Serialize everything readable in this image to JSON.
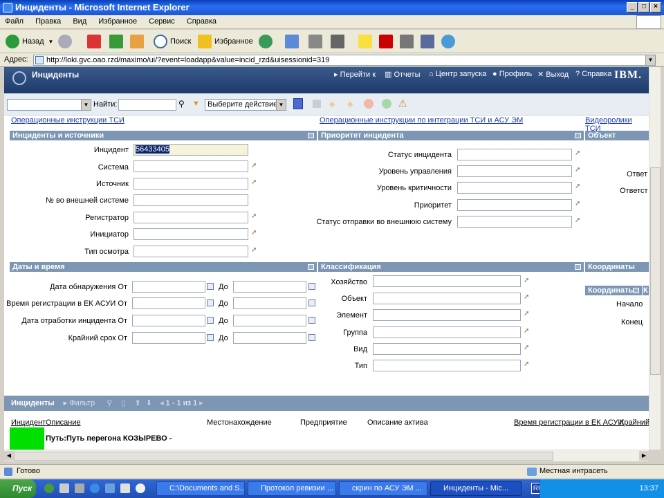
{
  "window": {
    "title": "Инциденты - Microsoft Internet Explorer"
  },
  "menu": [
    "Файл",
    "Правка",
    "Вид",
    "Избранное",
    "Сервис",
    "Справка"
  ],
  "toolbar": {
    "back": "Назад",
    "search": "Поиск",
    "favorites": "Избранное"
  },
  "address": {
    "label": "Адрес:",
    "url": "http://loki.gvc.oao.rzd/maximo/ui/?event=loadapp&value=incid_rzd&uisessionid=319"
  },
  "app": {
    "title": "Инциденты",
    "nav": [
      "Перейти к",
      "Отчеты",
      "Центр запуска",
      "Профиль",
      "Выход",
      "Справка"
    ],
    "brand": "IBM."
  },
  "actions": {
    "find_label": "Найти:",
    "action_select": "Выберите действие"
  },
  "links": {
    "l1": "Операционные инструкции ТСИ",
    "l2": "Операционные инструкции по интеграции ТСИ и АСУ ЭМ",
    "l3": "Видеоролики ТСИ"
  },
  "sections": {
    "incidents": "Инциденты и источники",
    "priority": "Приоритет инцидента",
    "object": "Объект",
    "dates": "Даты и время",
    "classification": "Классификация",
    "coords": "Координаты",
    "coords_sub": "Координаты",
    "coords_sub2": "К"
  },
  "incident_fields": {
    "incident": "Инцидент",
    "incident_value": "56433405",
    "system": "Система",
    "source": "Источник",
    "ext_number": "№ во внешней системе",
    "registrar": "Регистратор",
    "initiator": "Инициатор",
    "inspection": "Тип осмотра"
  },
  "priority_fields": {
    "status": "Статус инцидента",
    "mgmt_level": "Уровень управления",
    "crit_level": "Уровень критичности",
    "priority": "Приоритет",
    "ext_status": "Статус отправки во внешнюю систему"
  },
  "object_fields": {
    "resp1": "Ответ",
    "resp2": "Ответст"
  },
  "date_fields": {
    "detect": "Дата обнаружения От",
    "reg": "Время регистрации в ЕК АСУИ От",
    "work": "Дата отработки инцидента От",
    "deadline": "Крайний срок От",
    "to": "До"
  },
  "class_fields": {
    "farm": "Хозяйство",
    "object": "Объект",
    "element": "Элемент",
    "group": "Группа",
    "kind": "Вид",
    "type": "Тип"
  },
  "coord_fields": {
    "start": "Начало",
    "end": "Конец"
  },
  "table": {
    "title": "Инциденты",
    "filter": "Фильтр",
    "pager": "1 - 1 из 1",
    "columns": [
      "Инцидент",
      "Описание",
      "Местонахождение",
      "Предприятие",
      "Описание актива",
      "Время регистрации в ЕК АСУИ",
      "Крайний"
    ],
    "row_text": "Путь:Путь перегона КОЗЫРЕВО -",
    "row_status_color": "#00e000"
  },
  "status": {
    "left": "Готово",
    "right": "Местная интрасеть"
  },
  "taskbar": {
    "start": "Пуск",
    "tasks": [
      "C:\\Documents and S...",
      "Протокол ревизии ...",
      "скрин по АСУ ЭМ ...",
      "Инциденты - Mic..."
    ],
    "lang": "RU",
    "clock": "13:37"
  }
}
